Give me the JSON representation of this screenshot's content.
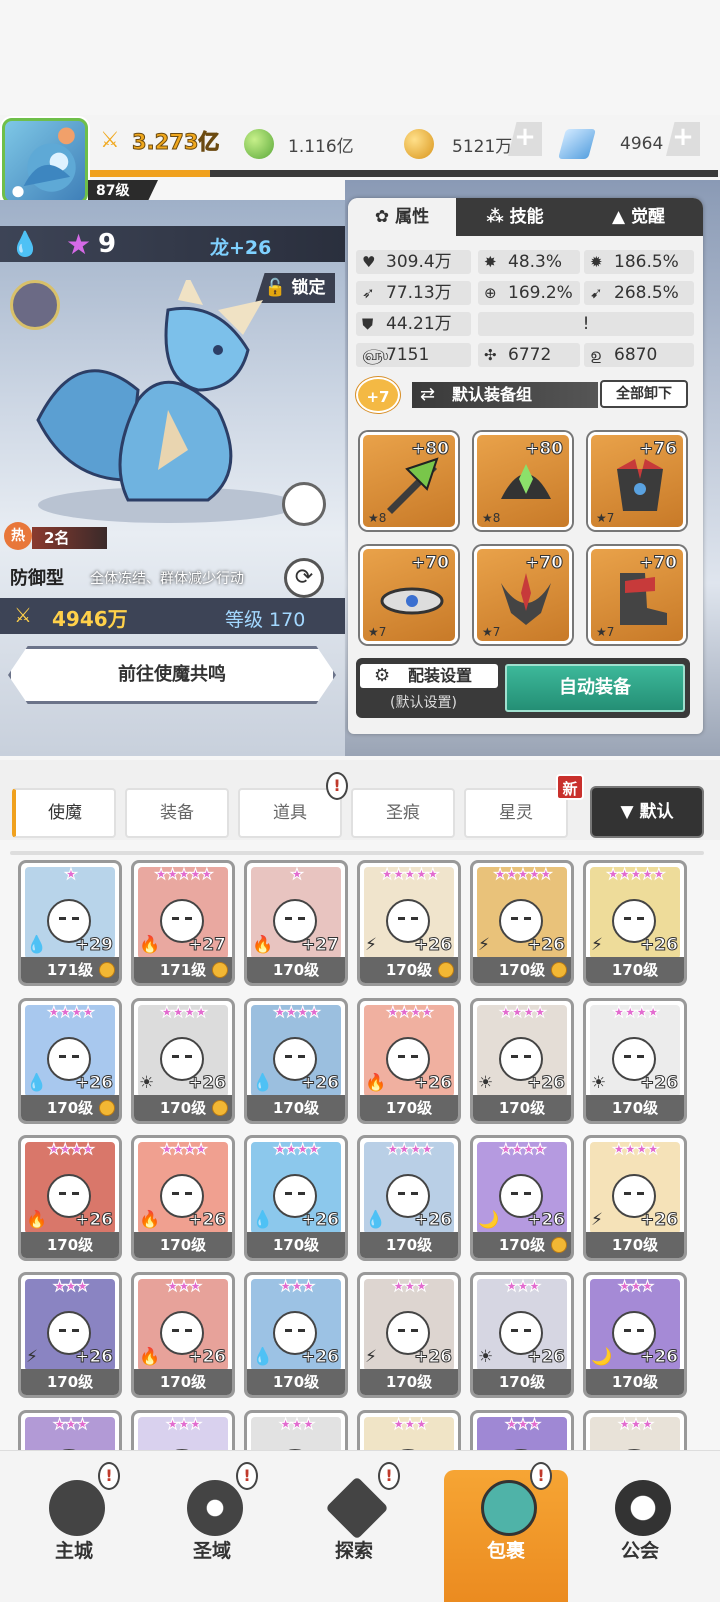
{
  "header": {
    "player_level": "87级",
    "combat_power": "3.273亿",
    "resources": [
      {
        "name": "green-orb-icon",
        "value": "1.116亿",
        "color": "#7cc94a"
      },
      {
        "name": "gold-coin-icon",
        "value": "5121万",
        "color": "#f2b734"
      },
      {
        "name": "blue-crystal-icon",
        "value": "4964",
        "color": "#7ab8ea"
      }
    ],
    "plus": "+"
  },
  "hero": {
    "stars": "9",
    "name": "龙+26",
    "lock_label": "锁定",
    "hot_label": "热",
    "rank": "2名",
    "role": "防御型",
    "role_desc": "全体冻结、群体减少行动",
    "power": "4946万",
    "level": "等级 170",
    "resonate_button": "前往使魔共鸣"
  },
  "panel": {
    "tabs": [
      "属性",
      "技能",
      "觉醒"
    ],
    "stats": {
      "hp": "309.4万",
      "crit": "48.3%",
      "crit_dmg": "186.5%",
      "atk": "77.13万",
      "hit": "169.2%",
      "speed_pct": "268.5%",
      "def": "44.21万",
      "v1": "7151",
      "v2": "6772",
      "v3": "6870",
      "alert": "!"
    },
    "set_badge": "+7",
    "set_name": "默认装备组",
    "unequip_all": "全部卸下",
    "equipment": [
      {
        "plus": "+80",
        "stars": "★8"
      },
      {
        "plus": "+80",
        "stars": "★8"
      },
      {
        "plus": "+76",
        "stars": "★7"
      },
      {
        "plus": "+70",
        "stars": "★7"
      },
      {
        "plus": "+70",
        "stars": "★7"
      },
      {
        "plus": "+70",
        "stars": "★7"
      }
    ],
    "config_label": "配装设置",
    "config_sub": "(默认设置)",
    "auto_equip": "自动装备"
  },
  "categories": {
    "tabs": [
      "使魔",
      "装备",
      "道具",
      "圣痕",
      "星灵"
    ],
    "new_badge": "新",
    "sort": "▼ 默认",
    "alert": "!"
  },
  "cards": [
    {
      "stars": "★",
      "plus": "+29",
      "level": "171级",
      "elem": "💧",
      "bg": "#b8d4ea"
    },
    {
      "stars": "★★★★★",
      "plus": "+27",
      "level": "171级",
      "elem": "🔥",
      "bg": "#e9a8a0"
    },
    {
      "stars": "★",
      "plus": "+27",
      "level": "170级",
      "elem": "🔥",
      "bg": "#e8c4c0"
    },
    {
      "stars": "★★★★★",
      "plus": "+26",
      "level": "170级",
      "elem": "⚡",
      "bg": "#f0e4cc"
    },
    {
      "stars": "★★★★★",
      "plus": "+26",
      "level": "170级",
      "elem": "⚡",
      "bg": "#e9c27a"
    },
    {
      "stars": "★★★★★",
      "plus": "+26",
      "level": "170级",
      "elem": "⚡",
      "bg": "#eedc9a"
    },
    {
      "stars": "★★★★",
      "plus": "+26",
      "level": "170级",
      "elem": "💧",
      "bg": "#a8c8ee"
    },
    {
      "stars": "★★★★",
      "plus": "+26",
      "level": "170级",
      "elem": "☀",
      "bg": "#dcdcdc"
    },
    {
      "stars": "★★★★",
      "plus": "+26",
      "level": "170级",
      "elem": "💧",
      "bg": "#9bbfdf"
    },
    {
      "stars": "★★★★",
      "plus": "+26",
      "level": "170级",
      "elem": "🔥",
      "bg": "#f0b0a0"
    },
    {
      "stars": "★★★★",
      "plus": "+26",
      "level": "170级",
      "elem": "☀",
      "bg": "#e4ddd6"
    },
    {
      "stars": "★★★★",
      "plus": "+26",
      "level": "170级",
      "elem": "☀",
      "bg": "#ececec"
    },
    {
      "stars": "★★★★",
      "plus": "+26",
      "level": "170级",
      "elem": "🔥",
      "bg": "#d9776a"
    },
    {
      "stars": "★★★★",
      "plus": "+26",
      "level": "170级",
      "elem": "🔥",
      "bg": "#f0a090"
    },
    {
      "stars": "★★★★",
      "plus": "+26",
      "level": "170级",
      "elem": "💧",
      "bg": "#8cc8ec"
    },
    {
      "stars": "★★★★",
      "plus": "+26",
      "level": "170级",
      "elem": "💧",
      "bg": "#b9cfe6"
    },
    {
      "stars": "★★★★",
      "plus": "+26",
      "level": "170级",
      "elem": "🌙",
      "bg": "#b59ae0"
    },
    {
      "stars": "★★★★",
      "plus": "+26",
      "level": "170级",
      "elem": "⚡",
      "bg": "#f5e2b8"
    },
    {
      "stars": "★★★",
      "plus": "+26",
      "level": "170级",
      "elem": "⚡",
      "bg": "#8a84c2"
    },
    {
      "stars": "★★★",
      "plus": "+26",
      "level": "170级",
      "elem": "🔥",
      "bg": "#e7a29a"
    },
    {
      "stars": "★★★",
      "plus": "+26",
      "level": "170级",
      "elem": "💧",
      "bg": "#9cc2e4"
    },
    {
      "stars": "★★★",
      "plus": "+26",
      "level": "170级",
      "elem": "⚡",
      "bg": "#ddd5d0"
    },
    {
      "stars": "★★★",
      "plus": "+26",
      "level": "170级",
      "elem": "☀",
      "bg": "#d6d6e2"
    },
    {
      "stars": "★★★",
      "plus": "+26",
      "level": "170级",
      "elem": "🌙",
      "bg": "#a58ad6"
    },
    {
      "stars": "★★★",
      "plus": "",
      "level": "",
      "elem": "",
      "bg": "#b29ad6"
    },
    {
      "stars": "★★★",
      "plus": "",
      "level": "",
      "elem": "",
      "bg": "#d9d1ee"
    },
    {
      "stars": "★★★",
      "plus": "",
      "level": "",
      "elem": "",
      "bg": "#e2e2e2"
    },
    {
      "stars": "★★★",
      "plus": "",
      "level": "",
      "elem": "",
      "bg": "#f0e4c6"
    },
    {
      "stars": "★★★",
      "plus": "",
      "level": "",
      "elem": "",
      "bg": "#9f88d4"
    },
    {
      "stars": "★★★",
      "plus": "",
      "level": "",
      "elem": "",
      "bg": "#e8e2d8"
    }
  ],
  "nav": {
    "items": [
      "主城",
      "圣域",
      "探索",
      "包裹",
      "公会"
    ],
    "alert": "!"
  }
}
